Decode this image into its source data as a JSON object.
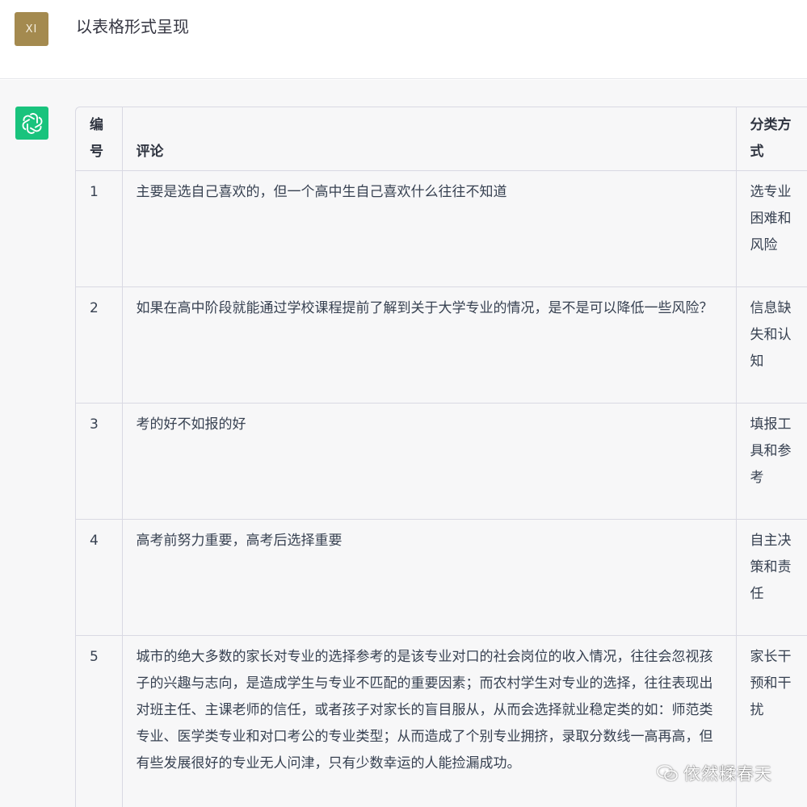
{
  "user": {
    "avatar_text": "XI",
    "message": "以表格形式呈现"
  },
  "assistant": {
    "avatar_icon": "openai-logo-icon",
    "table": {
      "headers": [
        "编号",
        "评论",
        "分类方式"
      ],
      "rows": [
        {
          "no": "1",
          "comment": "主要是选自己喜欢的，但一个高中生自己喜欢什么往往不知道",
          "category": "选专业困难和风险"
        },
        {
          "no": "2",
          "comment": "如果在高中阶段就能通过学校课程提前了解到关于大学专业的情况，是不是可以降低一些风险？",
          "category": "信息缺失和认知"
        },
        {
          "no": "3",
          "comment": "考的好不如报的好",
          "category": "填报工具和参考"
        },
        {
          "no": "4",
          "comment": "高考前努力重要，高考后选择重要",
          "category": "自主决策和责任"
        },
        {
          "no": "5",
          "comment": "城市的绝大多数的家长对专业的选择参考的是该专业对口的社会岗位的收入情况，往往会忽视孩子的兴趣与志向，是造成学生与专业不匹配的重要因素；而农村学生对专业的选择，往往表现出对班主任、主课老师的信任，或者孩子对家长的盲目服从，从而会选择就业稳定类的如：师范类专业、医学类专业和对口考公的专业类型；从而造成了个别专业拥挤，录取分数线一高再高，但有些发展很好的专业无人问津，只有少数幸运的人能捡漏成功。",
          "category": "家长干预和干扰"
        }
      ]
    }
  },
  "watermark": {
    "text": "依然糅春天",
    "icon": "wechat-icon"
  },
  "colors": {
    "user_avatar_bg": "#a48a4f",
    "bot_avatar_bg": "#19c37d",
    "bot_row_bg": "#f7f7f8",
    "border": "#d9d9e3"
  }
}
